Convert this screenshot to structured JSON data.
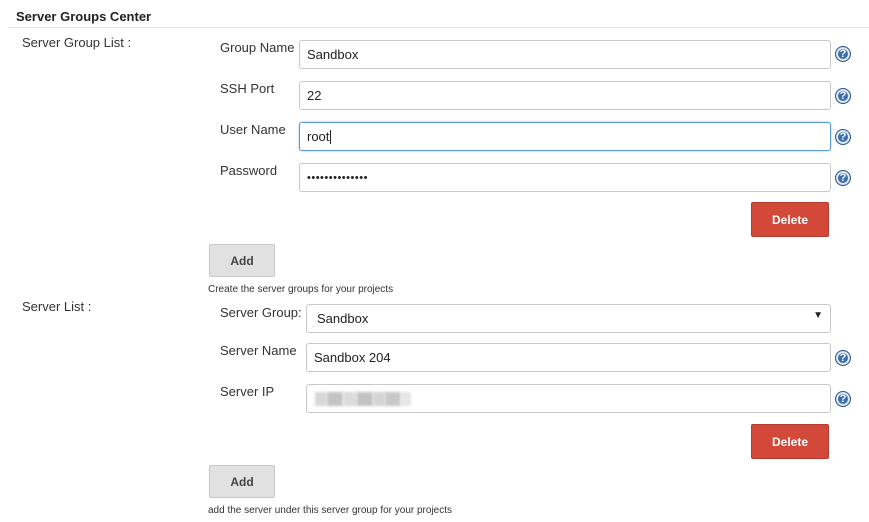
{
  "section": {
    "title": "Server Groups Center"
  },
  "server_group_list": {
    "label": "Server Group List :",
    "fields": {
      "group_name": {
        "label": "Group Name",
        "value": "Sandbox"
      },
      "ssh_port": {
        "label": "SSH Port",
        "value": "22"
      },
      "user_name": {
        "label": "User Name",
        "value": "root"
      },
      "password": {
        "label": "Password",
        "value": "••••••••••••••"
      }
    },
    "help_icon": "question-mark-circle-icon",
    "delete_label": "Delete",
    "add_label": "Add",
    "hint": "Create the server groups for your projects"
  },
  "server_list": {
    "label": "Server List :",
    "fields": {
      "server_group": {
        "label": "Server Group:",
        "selected": "Sandbox"
      },
      "server_name": {
        "label": "Server Name",
        "value": "Sandbox 204"
      },
      "server_ip": {
        "label": "Server IP",
        "value": ""
      }
    },
    "help_icon": "question-mark-circle-icon",
    "delete_label": "Delete",
    "add_label": "Add",
    "hint": "add the server under this server group for your projects"
  },
  "colors": {
    "delete_button": "#d24939",
    "add_button": "#e1e1e1",
    "help_icon": "#3a6fb0",
    "focus_border": "#5b9bd5"
  }
}
